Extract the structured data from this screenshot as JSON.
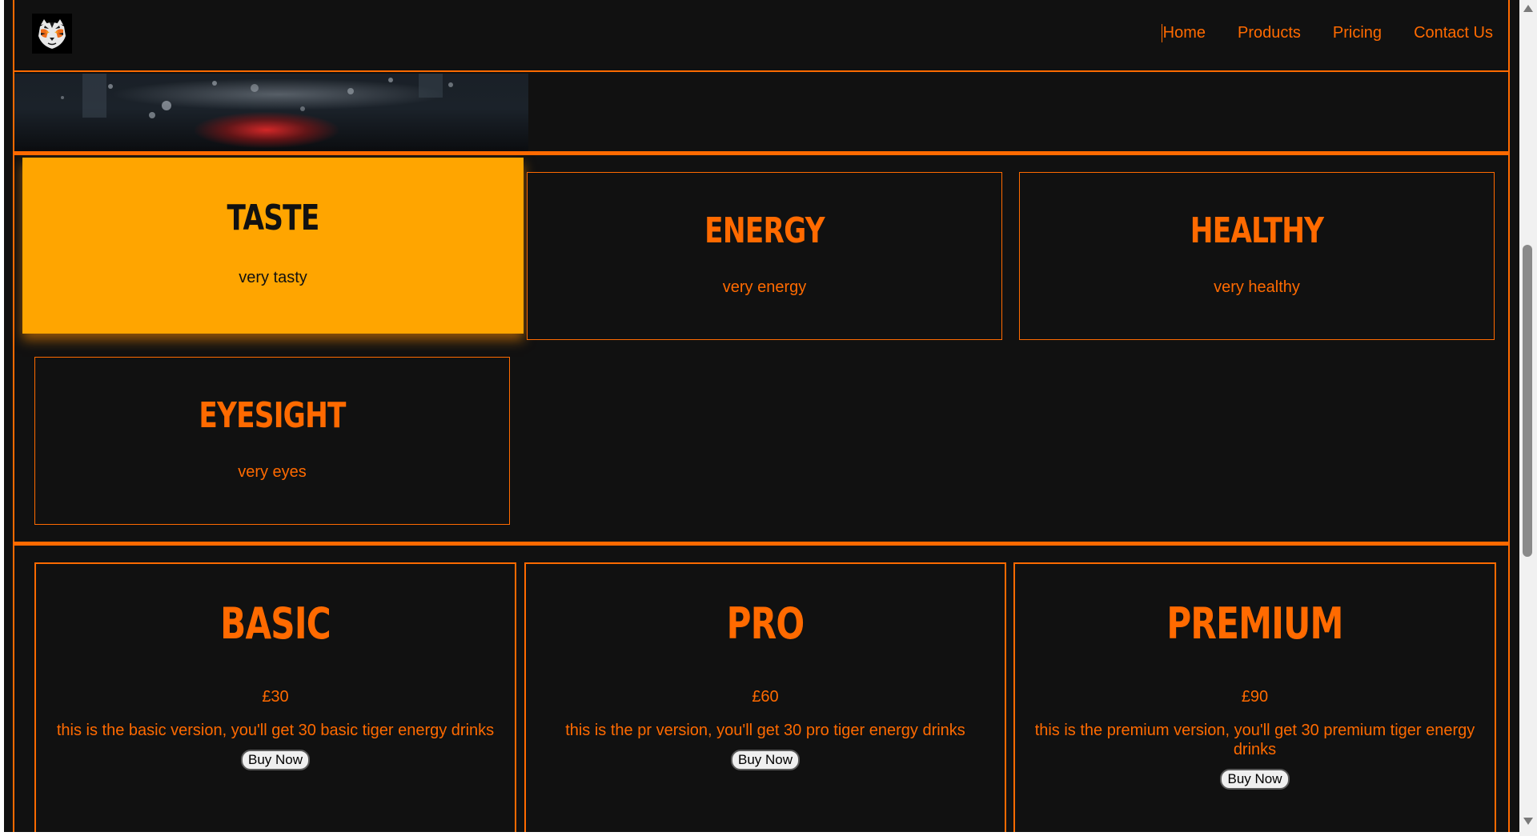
{
  "logo": {
    "icon": "tiger-icon",
    "alt": "Tiger logo"
  },
  "nav": {
    "items": [
      {
        "label": "Home"
      },
      {
        "label": "Products"
      },
      {
        "label": "Pricing"
      },
      {
        "label": "Contact Us"
      }
    ]
  },
  "features": {
    "items": [
      {
        "title": "TASTE",
        "desc": "very tasty",
        "state": "hovered"
      },
      {
        "title": "ENERGY",
        "desc": "very energy",
        "state": "normal"
      },
      {
        "title": "HEALTHY",
        "desc": "very healthy",
        "state": "normal"
      },
      {
        "title": "EYESIGHT",
        "desc": "very eyes",
        "state": "normal"
      }
    ]
  },
  "pricing": {
    "plans": [
      {
        "title": "BASIC",
        "price": "£30",
        "desc": "this is the basic version, you'll get 30 basic tiger energy drinks",
        "button": "Buy Now"
      },
      {
        "title": "PRO",
        "price": "£60",
        "desc": "this is the pr version, you'll get 30 pro tiger energy drinks",
        "button": "Buy Now"
      },
      {
        "title": "PREMIUM",
        "price": "£90",
        "desc": "this is the premium version, you'll get 30 premium tiger energy drinks",
        "button": "Buy Now"
      }
    ]
  },
  "colors": {
    "background": "#111111",
    "accent": "#ff6a00",
    "hover_card": "#ffa500",
    "button_bg": "#efefef"
  }
}
